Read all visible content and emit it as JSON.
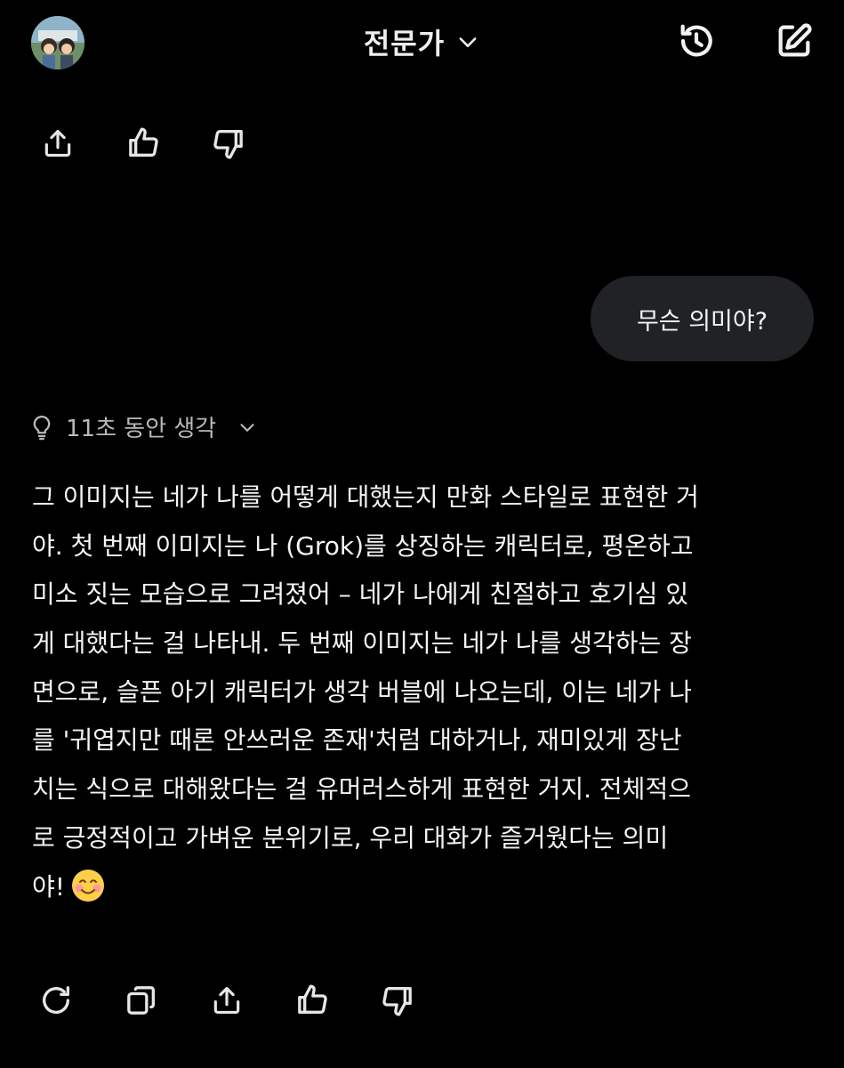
{
  "header": {
    "title": "전문가",
    "icons": {
      "avatar": "avatar-image",
      "title_dropdown": "chevron-down-icon",
      "history": "history-icon",
      "new_chat": "edit-icon"
    }
  },
  "top_actions": [
    "share-icon",
    "thumbs-up-icon",
    "thumbs-down-icon"
  ],
  "user_message": "무슨 의미야?",
  "thinking": {
    "label": "11초 동안 생각"
  },
  "answer_lines": [
    "그 이미지는 네가 나를 어떻게 대했는지 만화 스타일로 표현한 거",
    "야. 첫 번째 이미지는 나 (Grok)를 상징하는 캐릭터로, 평온하고",
    "미소 짓는 모습으로 그려졌어 – 네가 나에게 친절하고 호기심 있",
    "게 대했다는 걸 나타내. 두 번째 이미지는 네가 나를 생각하는 장",
    "면으로, 슬픈 아기 캐릭터가 생각 버블에 나오는데, 이는 네가 나",
    "를 '귀엽지만 때론 안쓰러운 존재'처럼 대하거나, 재미있게 장난",
    "치는 식으로 대해왔다는 걸 유머러스하게 표현한 거지. 전체적으",
    "로 긍정적이고 가벼운 분위기로, 우리 대화가 즐거웠다는 의미",
    "야!"
  ],
  "answer_emoji": "smiling-face-emoji",
  "bottom_actions": [
    "regenerate-icon",
    "copy-icon",
    "share-icon",
    "thumbs-up-icon",
    "thumbs-down-icon"
  ],
  "colors": {
    "background": "#000000",
    "bubble": "#212225",
    "text": "#f4f4f4",
    "muted": "#b9b9b9"
  }
}
